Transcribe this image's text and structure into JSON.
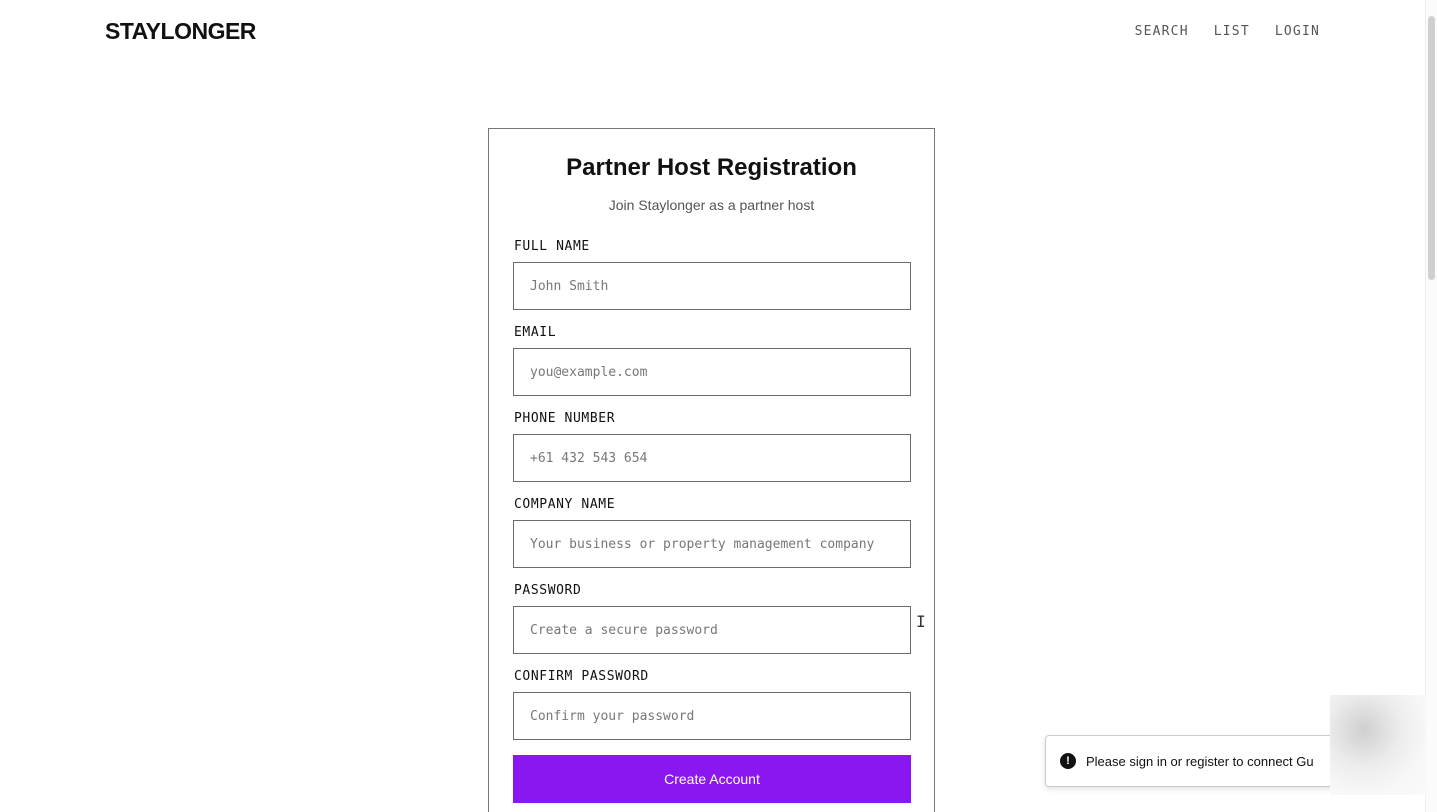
{
  "brand": "STAYLONGER",
  "nav": {
    "items": [
      "SEARCH",
      "LIST",
      "LOGIN"
    ]
  },
  "form": {
    "title": "Partner Host Registration",
    "subtitle": "Join Staylonger as a partner host",
    "fields": [
      {
        "label": "FULL NAME",
        "placeholder": "John Smith",
        "value": ""
      },
      {
        "label": "EMAIL",
        "placeholder": "you@example.com",
        "value": ""
      },
      {
        "label": "PHONE NUMBER",
        "placeholder": "+61 432 543 654",
        "value": ""
      },
      {
        "label": "COMPANY NAME",
        "placeholder": "Your business or property management company",
        "value": ""
      },
      {
        "label": "PASSWORD",
        "placeholder": "Create a secure password",
        "value": ""
      },
      {
        "label": "CONFIRM PASSWORD",
        "placeholder": "Confirm your password",
        "value": ""
      }
    ],
    "submit_label": "Create Account"
  },
  "toast": {
    "icon": "exclamation-icon",
    "icon_glyph": "!",
    "message": "Please sign in or register to connect Gu"
  },
  "cursor": {
    "icon": "text-cursor-icon",
    "glyph": "I"
  },
  "colors": {
    "accent": "#8a16f0",
    "text": "#111111",
    "muted": "#555555",
    "border": "#6a6a6a"
  }
}
